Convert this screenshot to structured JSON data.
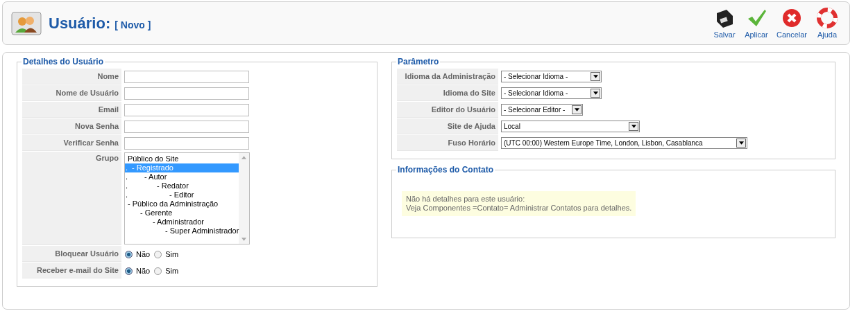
{
  "header": {
    "title": "Usuário:",
    "subtitle": "[ Novo ]"
  },
  "toolbar": [
    {
      "kind": "save",
      "label": "Salvar"
    },
    {
      "kind": "apply",
      "label": "Aplicar"
    },
    {
      "kind": "cancel",
      "label": "Cancelar"
    },
    {
      "kind": "help",
      "label": "Ajuda"
    }
  ],
  "user_details": {
    "legend": "Detalhes do Usuário",
    "fields": [
      {
        "label": "Nome"
      },
      {
        "label": "Nome de Usuário"
      },
      {
        "label": "Email"
      },
      {
        "label": "Nova Senha"
      },
      {
        "label": "Verificar Senha"
      }
    ],
    "group": {
      "label": "Grupo",
      "options": [
        {
          "text": "Público do Site",
          "selected": false,
          "children": [
            {
              "prefix": ".",
              "text": "- Registrado",
              "selected": true,
              "children": [
                {
                  "prefix": ".",
                  "text": "- Autor",
                  "selected": false,
                  "children": [
                    {
                      "prefix": ".",
                      "text": "- Redator",
                      "selected": false,
                      "children": [
                        {
                          "prefix": ".",
                          "text": "- Editor",
                          "selected": false
                        }
                      ]
                    }
                  ]
                }
              ]
            }
          ]
        },
        {
          "text": "- Público da Administração",
          "selected": false,
          "children": [
            {
              "text": "- Gerente",
              "selected": false,
              "children": [
                {
                  "text": "- Administrador",
                  "selected": false,
                  "children": [
                    {
                      "text": "- Super Administrador",
                      "selected": false
                    }
                  ]
                }
              ]
            }
          ]
        }
      ]
    },
    "radios": [
      {
        "label": "Bloquear Usuário",
        "options": [
          {
            "label": "Não",
            "selected": true
          },
          {
            "label": "Sim",
            "selected": false
          }
        ]
      },
      {
        "label": "Receber e-mail do Site",
        "options": [
          {
            "label": "Não",
            "selected": true
          },
          {
            "label": "Sim",
            "selected": false
          }
        ]
      }
    ]
  },
  "parameters": {
    "legend": "Parâmetro",
    "rows": [
      {
        "label": "Idioma da Administração",
        "value": "- Selecionar Idioma -"
      },
      {
        "label": "Idioma do Site",
        "value": "- Selecionar Idioma -"
      },
      {
        "label": "Editor do Usuário",
        "value": "- Selecionar Editor -"
      },
      {
        "label": "Site de Ajuda",
        "value": "Local"
      },
      {
        "label": "Fuso Horário",
        "value": "(UTC 00:00) Western Europe Time, London, Lisbon, Casablanca"
      }
    ]
  },
  "contact": {
    "legend": "Informações do Contato",
    "lines": [
      "Não há detalhes para este usuário:",
      "Veja Componentes =Contato= Administrar Contatos para detalhes."
    ]
  }
}
